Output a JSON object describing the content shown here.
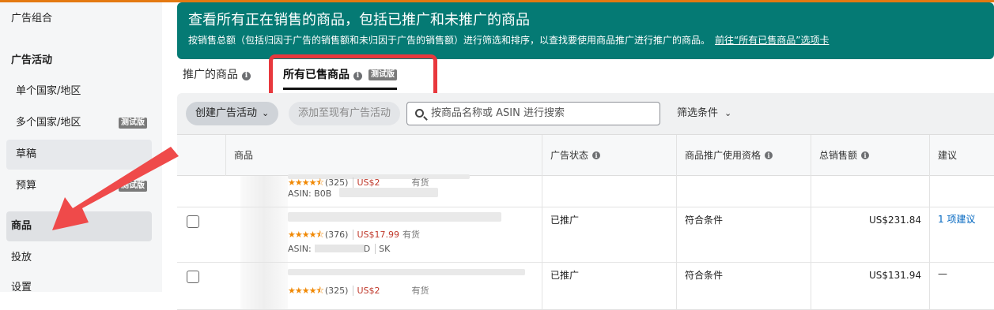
{
  "sidebar": {
    "items": [
      {
        "label": "广告组合"
      },
      {
        "label": "广告活动"
      },
      {
        "label": "单个国家/地区"
      },
      {
        "label": "多个国家/地区",
        "badge": "测试版"
      },
      {
        "label": "草稿"
      },
      {
        "label": "预算",
        "badge": "测试版"
      },
      {
        "label": "商品"
      },
      {
        "label": "投放"
      },
      {
        "label": "设置"
      }
    ]
  },
  "banner": {
    "title": "查看所有正在销售的商品，包括已推广和未推广的商品",
    "description": "按销售总额（包括归因于广告的销售额和未归因于广告的销售额）进行筛选和排序，以查找要使用商品推广进行推广的商品。",
    "link": "前往“所有已售商品”选项卡"
  },
  "tabs": [
    {
      "label": "推广的商品"
    },
    {
      "label": "所有已售商品",
      "badge": "测试版"
    }
  ],
  "toolbar": {
    "create_label": "创建广告活动",
    "add_label": "添加至现有广告活动",
    "search_placeholder": "按商品名称或 ASIN 进行搜索",
    "filter_label": "筛选条件"
  },
  "table": {
    "headers": [
      "商品",
      "广告状态",
      "商品推广使用资格",
      "总销售额",
      "建议"
    ],
    "rows": [
      {
        "rating": "(325)",
        "price": "US$2",
        "stock": "有货",
        "asin": "ASIN: B0B",
        "status": "",
        "eligibility": "",
        "sales": "",
        "suggestion": ""
      },
      {
        "rating": "(376)",
        "price": "US$17.99",
        "stock": "有货",
        "asin": "ASIN:",
        "asin_extra": "D",
        "sku": "SK",
        "status": "已推广",
        "eligibility": "符合条件",
        "sales": "US$231.84",
        "suggestion": "1 项建议"
      },
      {
        "rating": "(325)",
        "price": "US$2",
        "stock": "有货",
        "asin": "",
        "status": "已推广",
        "eligibility": "符合条件",
        "sales": "US$131.94",
        "suggestion": "—"
      }
    ]
  },
  "colors": {
    "banner": "#057a74",
    "accent_orange": "#e47911",
    "highlight_red": "#e8383d",
    "arrow_red": "#ef4a4a"
  }
}
